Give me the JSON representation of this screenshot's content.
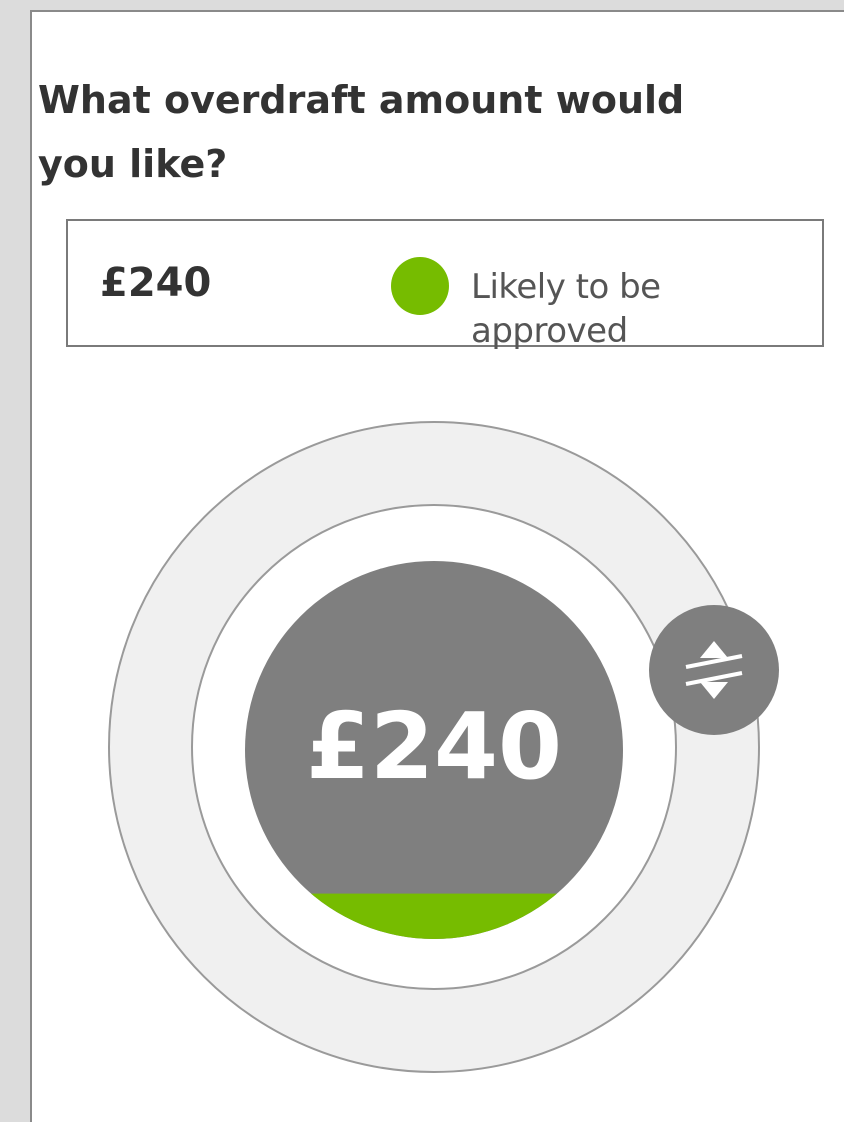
{
  "question": "What overdraft amount would you like?",
  "selected_amount": "£240",
  "status": {
    "label": "Likely to be approved",
    "color": "#76bc00"
  },
  "dial": {
    "amount_label": "£240",
    "approval_fill_fraction": 0.12,
    "handle_icon": "swap-vertical-icon"
  },
  "colors": {
    "approved_green": "#76bc00",
    "dial_grey": "#7f7f7f",
    "ring_grey": "#f0f0f0",
    "text_dark": "#333333"
  }
}
